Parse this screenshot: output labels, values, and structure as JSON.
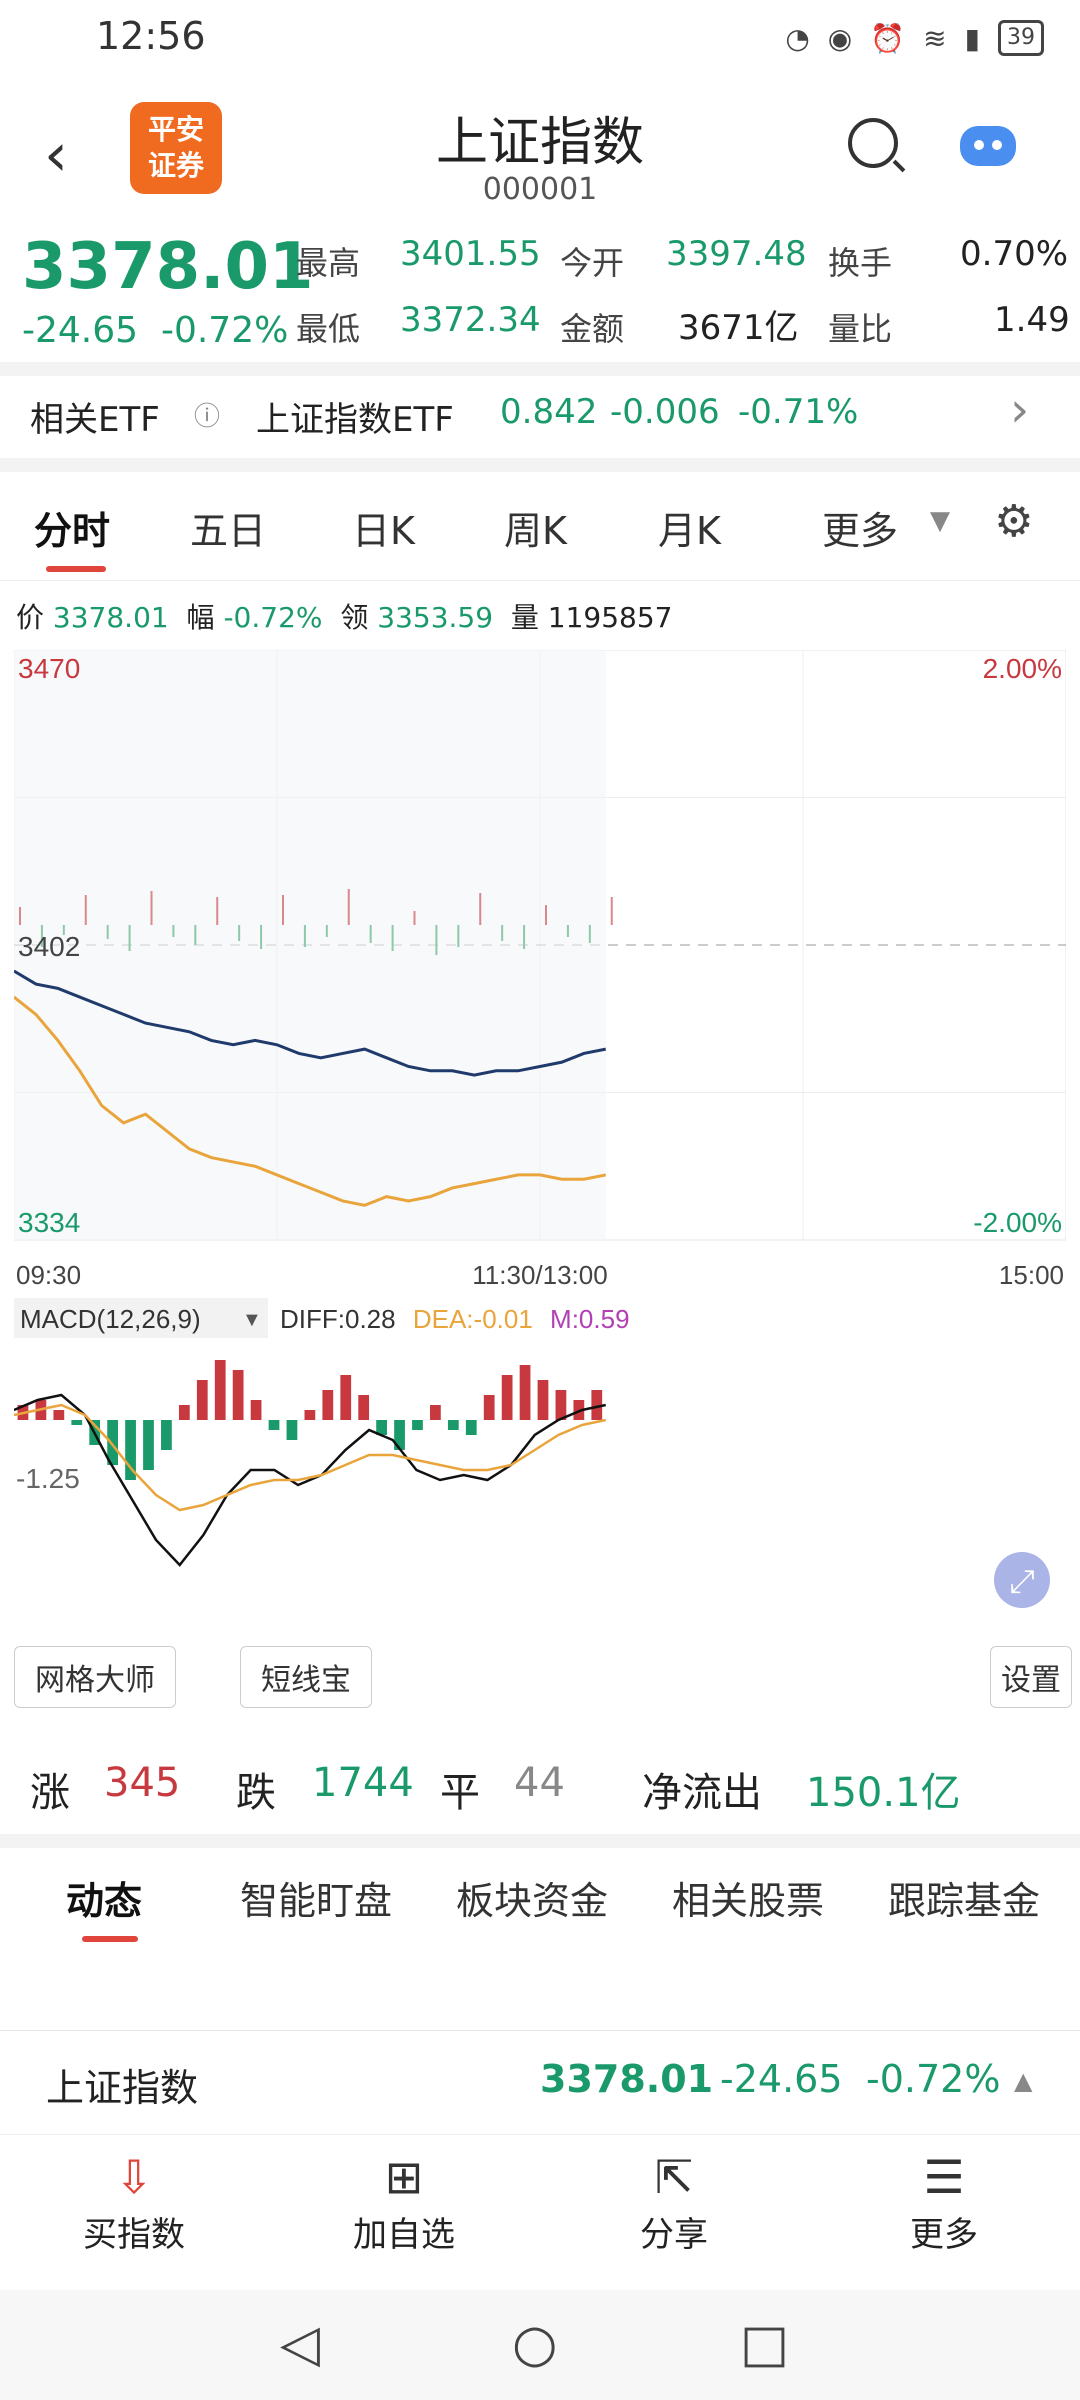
{
  "status": {
    "time": "12:56",
    "battery": "39"
  },
  "header": {
    "title": "上证指数",
    "code": "000001",
    "logo_line1": "平安",
    "logo_line2": "证券"
  },
  "quote": {
    "price": "3378.01",
    "change": "-24.65",
    "pct": "-0.72%",
    "high_label": "最高",
    "high": "3401.55",
    "low_label": "最低",
    "low": "3372.34",
    "open_label": "今开",
    "open": "3397.48",
    "amount_label": "金额",
    "amount": "3671亿",
    "turnover_label": "换手",
    "turnover": "0.70%",
    "volratio_label": "量比",
    "volratio": "1.49"
  },
  "etf": {
    "label": "相关ETF",
    "name": "上证指数ETF",
    "price": "0.842",
    "change": "-0.006",
    "pct": "-0.71%"
  },
  "tabs": [
    "分时",
    "五日",
    "日K",
    "周K",
    "月K",
    "更多"
  ],
  "info": {
    "price_label": "价",
    "price": "3378.01",
    "pct_label": "幅",
    "pct": "-0.72%",
    "lead_label": "领",
    "lead": "3353.59",
    "vol_label": "量",
    "vol": "1195857"
  },
  "chart_data": [
    {
      "type": "line",
      "ylim": [
        3334,
        3470
      ],
      "y_tick_labels": [
        "3470",
        "3402",
        "3334"
      ],
      "right_tick_labels": [
        "2.00%",
        "-2.00%"
      ],
      "x_tick_labels": [
        "09:30",
        "11:30/13:00",
        "15:00"
      ],
      "prev_close": 3402,
      "series": [
        {
          "color": "#1f3a6b",
          "values": [
            3396,
            3393,
            3392,
            3390,
            3388,
            3386,
            3384,
            3383,
            3382,
            3380,
            3379,
            3380,
            3379,
            3377,
            3376,
            3377,
            3378,
            3376,
            3374,
            3373,
            3373,
            3372,
            3373,
            3373,
            3374,
            3375,
            3377,
            3378
          ]
        },
        {
          "color": "#e9a53c",
          "values": [
            3390,
            3386,
            3380,
            3373,
            3365,
            3361,
            3363,
            3359,
            3355,
            3353,
            3352,
            3351,
            3349,
            3347,
            3345,
            3343,
            3342,
            3344,
            3343,
            3344,
            3346,
            3347,
            3348,
            3349,
            3349,
            3348,
            3348,
            3349
          ]
        }
      ]
    },
    {
      "type": "bar",
      "title": "MACD(12,26,9)",
      "y_tick_labels": [
        "-1.25"
      ],
      "diff_label": "DIFF:",
      "diff": "0.28",
      "dea_label": "DEA:",
      "dea": "-0.01",
      "m_label": "M:",
      "m": "0.59",
      "values": [
        0.3,
        0.4,
        0.2,
        -0.1,
        -0.5,
        -0.9,
        -1.2,
        -1.0,
        -0.6,
        0.3,
        0.8,
        1.2,
        1.0,
        0.4,
        -0.2,
        -0.4,
        0.2,
        0.6,
        0.9,
        0.5,
        -0.3,
        -0.6,
        -0.2,
        0.3,
        -0.2,
        -0.3,
        0.5,
        0.9,
        1.1,
        0.8,
        0.6,
        0.4,
        0.6
      ],
      "diff_series": [
        0.2,
        0.4,
        0.5,
        0.1,
        -0.8,
        -1.6,
        -2.4,
        -2.9,
        -2.3,
        -1.5,
        -1.0,
        -1.0,
        -1.3,
        -1.1,
        -0.6,
        -0.2,
        -0.4,
        -1.0,
        -1.2,
        -1.1,
        -1.2,
        -0.9,
        -0.3,
        0.0,
        0.2,
        0.3
      ],
      "dea_series": [
        0.1,
        0.2,
        0.3,
        0.1,
        -0.4,
        -1.0,
        -1.5,
        -1.8,
        -1.7,
        -1.5,
        -1.3,
        -1.2,
        -1.2,
        -1.1,
        -0.9,
        -0.7,
        -0.7,
        -0.8,
        -0.9,
        -1.0,
        -1.0,
        -0.9,
        -0.6,
        -0.3,
        -0.1,
        0.0
      ]
    }
  ],
  "tools": {
    "grid": "网格大师",
    "short": "短线宝",
    "settings": "设置"
  },
  "breadth": {
    "up_label": "涨",
    "up": "345",
    "down_label": "跌",
    "down": "1744",
    "flat_label": "平",
    "flat": "44",
    "flow_label": "净流出",
    "flow": "150.1亿"
  },
  "news_tabs": [
    "动态",
    "智能盯盘",
    "板块资金",
    "相关股票",
    "跟踪基金"
  ],
  "ticker": {
    "name": "上证指数",
    "price": "3378.01",
    "change": "-24.65",
    "pct": "-0.72%"
  },
  "actions": [
    "买指数",
    "加自选",
    "分享",
    "更多"
  ]
}
